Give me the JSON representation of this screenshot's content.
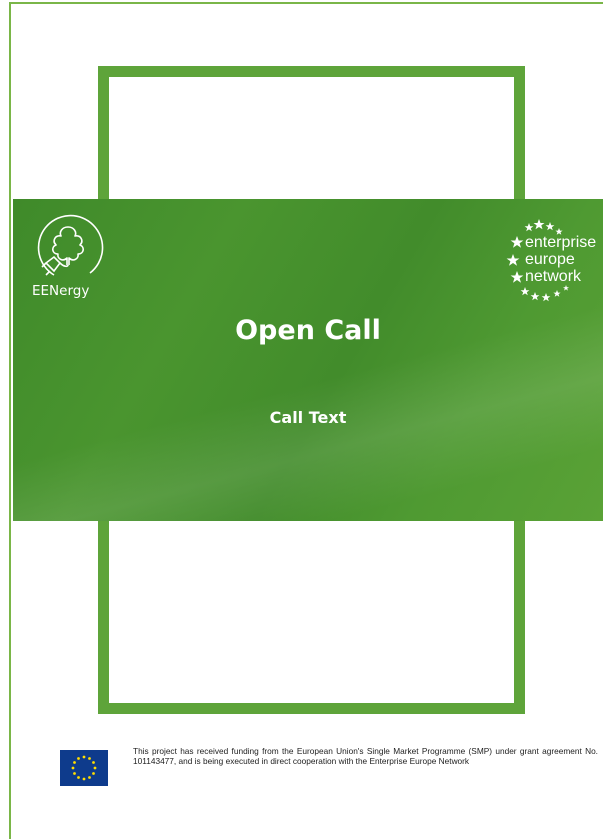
{
  "cover": {
    "title": "Open Call",
    "subtitle": "Call Text"
  },
  "logos": {
    "project_logo_name": "EENergy",
    "project_logo_icon": "oak-leaf-plug-icon",
    "network_logo_words": [
      "enterprise",
      "europe",
      "network"
    ],
    "network_logo_icon": "star-ring-icon"
  },
  "footer": {
    "flag_icon": "eu-flag-icon",
    "funding_text": "This project has received funding from the European Union's Single Market Programme (SMP) under grant agreement No. 101143477, and is being executed in direct cooperation with the Enterprise Europe Network"
  },
  "colors": {
    "frame_green": "#5ea43a",
    "band_green": "#4a952f",
    "page_border_green": "#7ab648",
    "eu_blue": "#0e3b8c",
    "eu_star_yellow": "#ffdd00"
  }
}
